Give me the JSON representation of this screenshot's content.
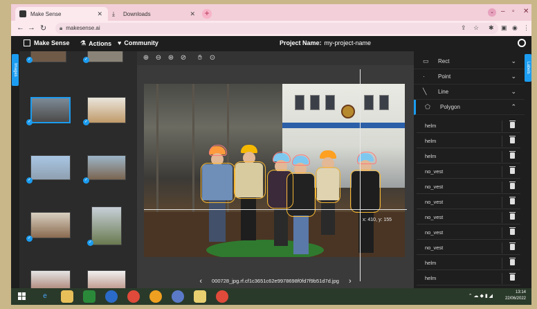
{
  "browser": {
    "tabs": [
      {
        "title": "Make Sense",
        "active": true
      },
      {
        "title": "Downloads",
        "active": false
      }
    ],
    "url": "makesense.ai"
  },
  "app": {
    "logo_label": "Make Sense",
    "menu": [
      {
        "label": "Actions",
        "icon": "actions-icon"
      },
      {
        "label": "Community",
        "icon": "heart-icon"
      }
    ],
    "project_label": "Project Name:",
    "project_name": "my-project-name",
    "left_tab_label": "Images",
    "right_tab_label": "Labels"
  },
  "editor": {
    "filename": "000728_jpg.rf.cf1c3651c62e9978698f0fd7f9b51d7d.jpg",
    "cursor_readout": "x: 410, y: 155"
  },
  "shapes": [
    {
      "label": "Rect",
      "icon": "rect-icon",
      "expanded": false
    },
    {
      "label": "Point",
      "icon": "point-icon",
      "expanded": false
    },
    {
      "label": "Line",
      "icon": "line-icon",
      "expanded": false
    },
    {
      "label": "Polygon",
      "icon": "polygon-icon",
      "expanded": true
    }
  ],
  "labels": [
    {
      "name": "helm"
    },
    {
      "name": "helm"
    },
    {
      "name": "helm"
    },
    {
      "name": "no_vest"
    },
    {
      "name": "no_vest"
    },
    {
      "name": "no_vest"
    },
    {
      "name": "no_vest"
    },
    {
      "name": "no_vest"
    },
    {
      "name": "no_vest"
    },
    {
      "name": "helm"
    },
    {
      "name": "helm"
    }
  ],
  "taskbar": {
    "time": "13:14",
    "date": "22/06/2022"
  },
  "colors": {
    "accent": "#1b9cf0",
    "polygon_outline": "#f6b733",
    "helmet_outline": "#ff7a7a"
  }
}
